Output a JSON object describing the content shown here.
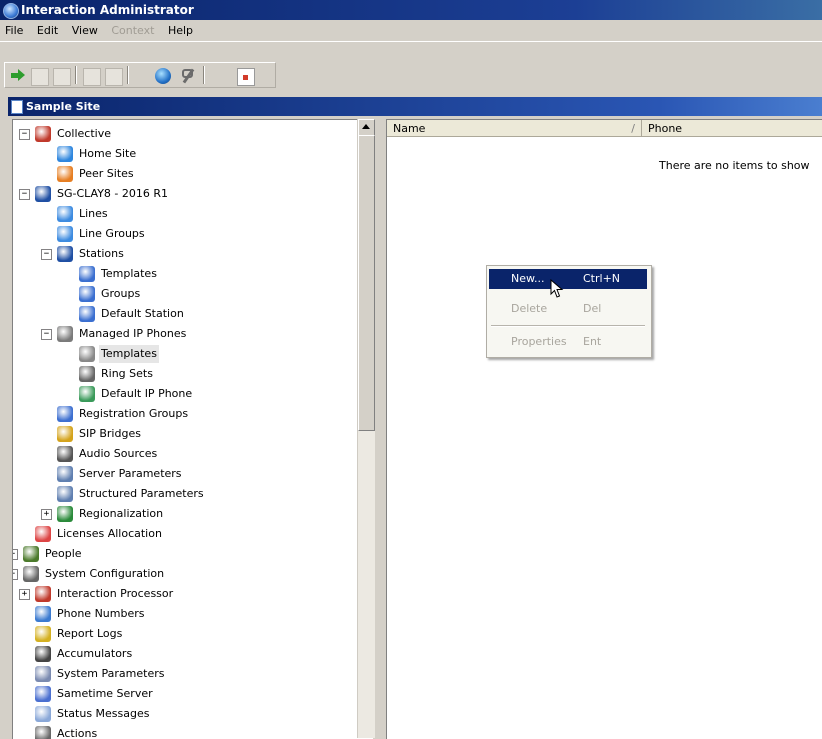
{
  "window": {
    "title": "Interaction Administrator"
  },
  "menu": [
    {
      "label": "File",
      "enabled": true
    },
    {
      "label": "Edit",
      "enabled": true
    },
    {
      "label": "View",
      "enabled": true
    },
    {
      "label": "Context",
      "enabled": false
    },
    {
      "label": "Help",
      "enabled": true
    }
  ],
  "toolbar": {
    "icons": [
      "new-icon",
      "move-icon",
      "delete-icon",
      "copy-icon",
      "paste-icon",
      "globe-icon",
      "tools-icon",
      "report-icon"
    ]
  },
  "panel": {
    "title": "Sample Site"
  },
  "tree": {
    "items": [
      {
        "label": "Collective",
        "icon": "collective-icon",
        "expander": "−"
      },
      {
        "label": "Home Site",
        "icon": "home-site-icon"
      },
      {
        "label": "Peer Sites",
        "icon": "peer-sites-icon"
      },
      {
        "label": "SG-CLAY8 - 2016 R1",
        "icon": "server-icon",
        "expander": "−"
      },
      {
        "label": "Lines",
        "icon": "lines-icon"
      },
      {
        "label": "Line Groups",
        "icon": "line-groups-icon"
      },
      {
        "label": "Stations",
        "icon": "stations-icon",
        "expander": "−"
      },
      {
        "label": "Templates",
        "icon": "station-templates-icon"
      },
      {
        "label": "Groups",
        "icon": "station-groups-icon"
      },
      {
        "label": "Default Station",
        "icon": "default-station-icon"
      },
      {
        "label": "Managed IP Phones",
        "icon": "managed-phones-icon",
        "expander": "−"
      },
      {
        "label": "Templates",
        "icon": "phone-templates-icon",
        "selected": true
      },
      {
        "label": "Ring Sets",
        "icon": "ring-sets-icon"
      },
      {
        "label": "Default IP Phone",
        "icon": "default-phone-icon"
      },
      {
        "label": "Registration Groups",
        "icon": "registration-groups-icon"
      },
      {
        "label": "SIP Bridges",
        "icon": "sip-bridges-icon"
      },
      {
        "label": "Audio Sources",
        "icon": "audio-sources-icon"
      },
      {
        "label": "Server Parameters",
        "icon": "server-parameters-icon"
      },
      {
        "label": "Structured Parameters",
        "icon": "structured-parameters-icon"
      },
      {
        "label": "Regionalization",
        "icon": "regionalization-icon",
        "expander": "+"
      },
      {
        "label": "Licenses Allocation",
        "icon": "licenses-icon"
      },
      {
        "label": "People",
        "icon": "people-icon",
        "expander": "+"
      },
      {
        "label": "System Configuration",
        "icon": "system-config-icon",
        "expander": "−"
      },
      {
        "label": "Interaction Processor",
        "icon": "interaction-processor-icon",
        "expander": "+"
      },
      {
        "label": "Phone Numbers",
        "icon": "phone-numbers-icon"
      },
      {
        "label": "Report Logs",
        "icon": "report-logs-icon"
      },
      {
        "label": "Accumulators",
        "icon": "accumulators-icon"
      },
      {
        "label": "System Parameters",
        "icon": "system-parameters-icon"
      },
      {
        "label": "Sametime Server",
        "icon": "sametime-icon"
      },
      {
        "label": "Status Messages",
        "icon": "status-messages-icon"
      },
      {
        "label": "Actions",
        "icon": "actions-icon"
      }
    ]
  },
  "list": {
    "columns": [
      {
        "label": "Name",
        "sort": "/"
      },
      {
        "label": "Phone"
      }
    ],
    "empty_message": "There are no items to show"
  },
  "context_menu": {
    "items": [
      {
        "label": "New...",
        "shortcut": "Ctrl+N",
        "state": "highlighted"
      },
      {
        "label": "Delete",
        "shortcut": "Del",
        "state": "disabled"
      },
      {
        "label": "Properties",
        "shortcut": "Ent",
        "state": "disabled"
      }
    ]
  },
  "colors": {
    "titlebar": "#0a246a",
    "highlight": "#0a246a",
    "chrome": "#d4d0c8"
  }
}
